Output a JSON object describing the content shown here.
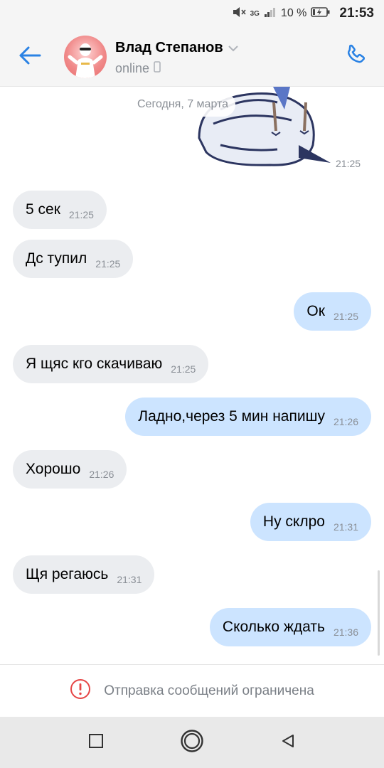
{
  "status_bar": {
    "network": "3G",
    "battery_percent": "10 %",
    "time": "21:53"
  },
  "header": {
    "contact_name": "Влад Степанов",
    "contact_status": "online",
    "accent_color": "#2a82e4"
  },
  "chat": {
    "date_label": "Сегодня, 7 марта",
    "sticker_time": "21:25",
    "messages": [
      {
        "direction": "in",
        "text": "5 сек",
        "time": "21:25"
      },
      {
        "direction": "in",
        "text": "Дс тупил",
        "time": "21:25"
      },
      {
        "direction": "out",
        "text": "Ок",
        "time": "21:25"
      },
      {
        "direction": "in",
        "text": "Я щяс кго скачиваю",
        "time": "21:25"
      },
      {
        "direction": "out",
        "text": "Ладно,через 5 мин напишу",
        "time": "21:26"
      },
      {
        "direction": "in",
        "text": "Хорошо",
        "time": "21:26"
      },
      {
        "direction": "out",
        "text": "Ну склро",
        "time": "21:31"
      },
      {
        "direction": "in",
        "text": "Щя регаюсь",
        "time": "21:31"
      },
      {
        "direction": "out",
        "text": "Сколько ждать",
        "time": "21:36"
      }
    ]
  },
  "notice": {
    "text": "Отправка сообщений ограничена",
    "icon": "warning-icon",
    "icon_color": "#e64646"
  },
  "navbar": {
    "buttons": [
      "recents-icon",
      "home-icon",
      "back-icon"
    ]
  }
}
